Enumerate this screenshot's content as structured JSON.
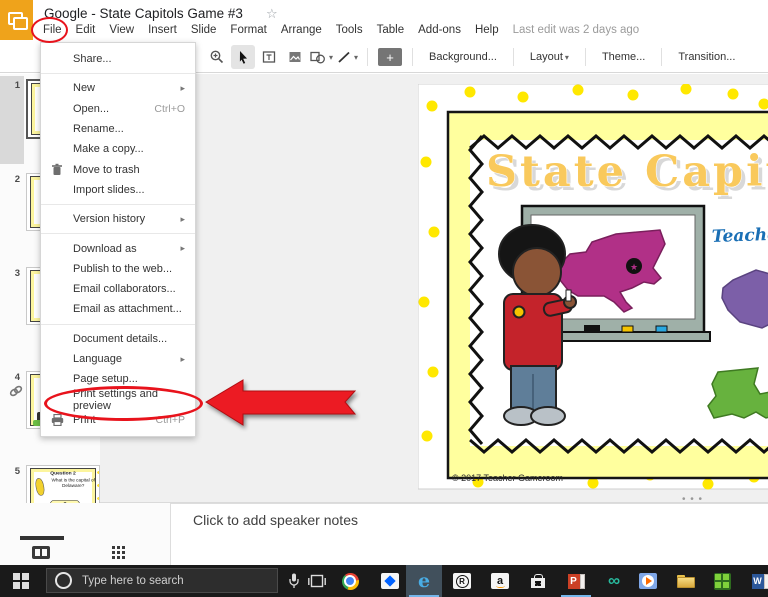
{
  "header": {
    "title": "Google - State Capitols Game #3",
    "star_icon": "☆",
    "menu": [
      "File",
      "Edit",
      "View",
      "Insert",
      "Slide",
      "Format",
      "Arrange",
      "Tools",
      "Table",
      "Add-ons",
      "Help"
    ],
    "last_edit": "Last edit was 2 days ago"
  },
  "toolbar": {
    "background": "Background...",
    "layout": "Layout",
    "theme": "Theme...",
    "transition": "Transition..."
  },
  "file_menu": {
    "items": [
      {
        "label": "Share..."
      },
      {
        "label": "New",
        "submenu": "▸"
      },
      {
        "label": "Open...",
        "shortcut": "Ctrl+O"
      },
      {
        "label": "Rename..."
      },
      {
        "label": "Make a copy..."
      },
      {
        "label": "Move to trash",
        "icon": "trash"
      },
      {
        "label": "Import slides..."
      },
      {
        "label": "Version history",
        "submenu": "▸"
      },
      {
        "label": "Download as",
        "submenu": "▸"
      },
      {
        "label": "Publish to the web..."
      },
      {
        "label": "Email collaborators..."
      },
      {
        "label": "Email as attachment..."
      },
      {
        "label": "Document details..."
      },
      {
        "label": "Language",
        "submenu": "▸"
      },
      {
        "label": "Page setup..."
      },
      {
        "label": "Print settings and preview",
        "annotated": true
      },
      {
        "label": "Print",
        "shortcut": "Ctrl+P",
        "icon": "printer"
      }
    ]
  },
  "filmstrip": {
    "slide_numbers": [
      "1",
      "2",
      "3",
      "4",
      "5"
    ]
  },
  "slide": {
    "title": "State Capit",
    "brand_script": "Teache",
    "credit": "© 2017 Teacher  Gameroom",
    "colors": {
      "dot": "#FFE800",
      "frame": "#FFFF9E",
      "ny": "#B13087",
      "purple": "#7C5FA8",
      "green": "#67B23E",
      "title": "#F9C95C",
      "script_blue": "#1A6FB5"
    }
  },
  "thumb5": {
    "q_label": "Question 2",
    "q_text": "What is the capital of Delaware?",
    "answer": "?"
  },
  "notes": {
    "placeholder": "Click to add speaker notes"
  },
  "taskbar": {
    "search_placeholder": "Type here to search"
  },
  "annotation": {
    "color": "#E8131C"
  }
}
